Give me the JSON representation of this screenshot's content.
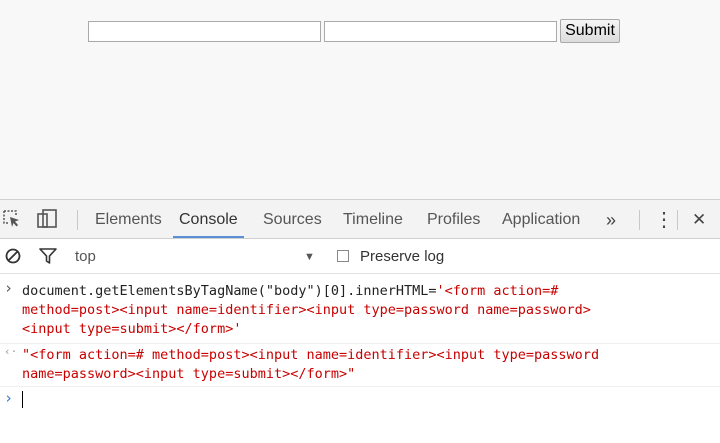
{
  "page": {
    "form": {
      "identifier_value": "",
      "password_value": "",
      "submit_label": "Submit"
    }
  },
  "devtools": {
    "tabs": [
      "Elements",
      "Console",
      "Sources",
      "Timeline",
      "Profiles",
      "Application"
    ],
    "active_tab": "Console",
    "more_tabs_glyph": "»",
    "menu_glyph": "⋮",
    "close_glyph": "✕",
    "context": "top",
    "context_dropdown_glyph": "▼",
    "preserve_log_label": "Preserve log",
    "input_prompt_glyph": "›",
    "output_prompt_glyph": "‹·",
    "command": {
      "line1_code": "document.getElementsByTagName(\"body\")[0].innerHTML=",
      "line1_str": "'<form action=#",
      "line2_str": "method=post><input name=identifier><input type=password name=password>",
      "line3_str": "<input type=submit></form>'"
    },
    "result": {
      "line1": "\"<form action=# method=post><input name=identifier><input type=password",
      "line2": "name=password><input type=submit></form>\""
    },
    "colors": {
      "accent": "#5a8fd6",
      "string": "#c80000",
      "prompt_blue": "#3875d7"
    }
  }
}
